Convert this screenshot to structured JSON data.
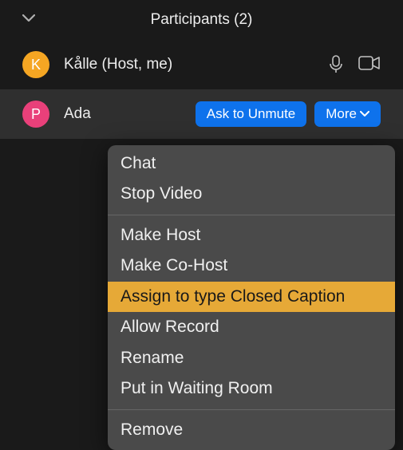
{
  "header": {
    "title": "Participants (2)"
  },
  "participants": [
    {
      "initial": "K",
      "name": "Kålle (Host, me)",
      "avatar_color": "#f5a623"
    },
    {
      "initial": "P",
      "name": "Ada",
      "avatar_color": "#e9407a"
    }
  ],
  "actions": {
    "ask_unmute": "Ask to Unmute",
    "more": "More"
  },
  "menu": {
    "chat": "Chat",
    "stop_video": "Stop Video",
    "make_host": "Make Host",
    "make_cohost": "Make Co-Host",
    "assign_cc": "Assign to type Closed Caption",
    "allow_record": "Allow Record",
    "rename": "Rename",
    "waiting_room": "Put in Waiting Room",
    "remove": "Remove"
  }
}
